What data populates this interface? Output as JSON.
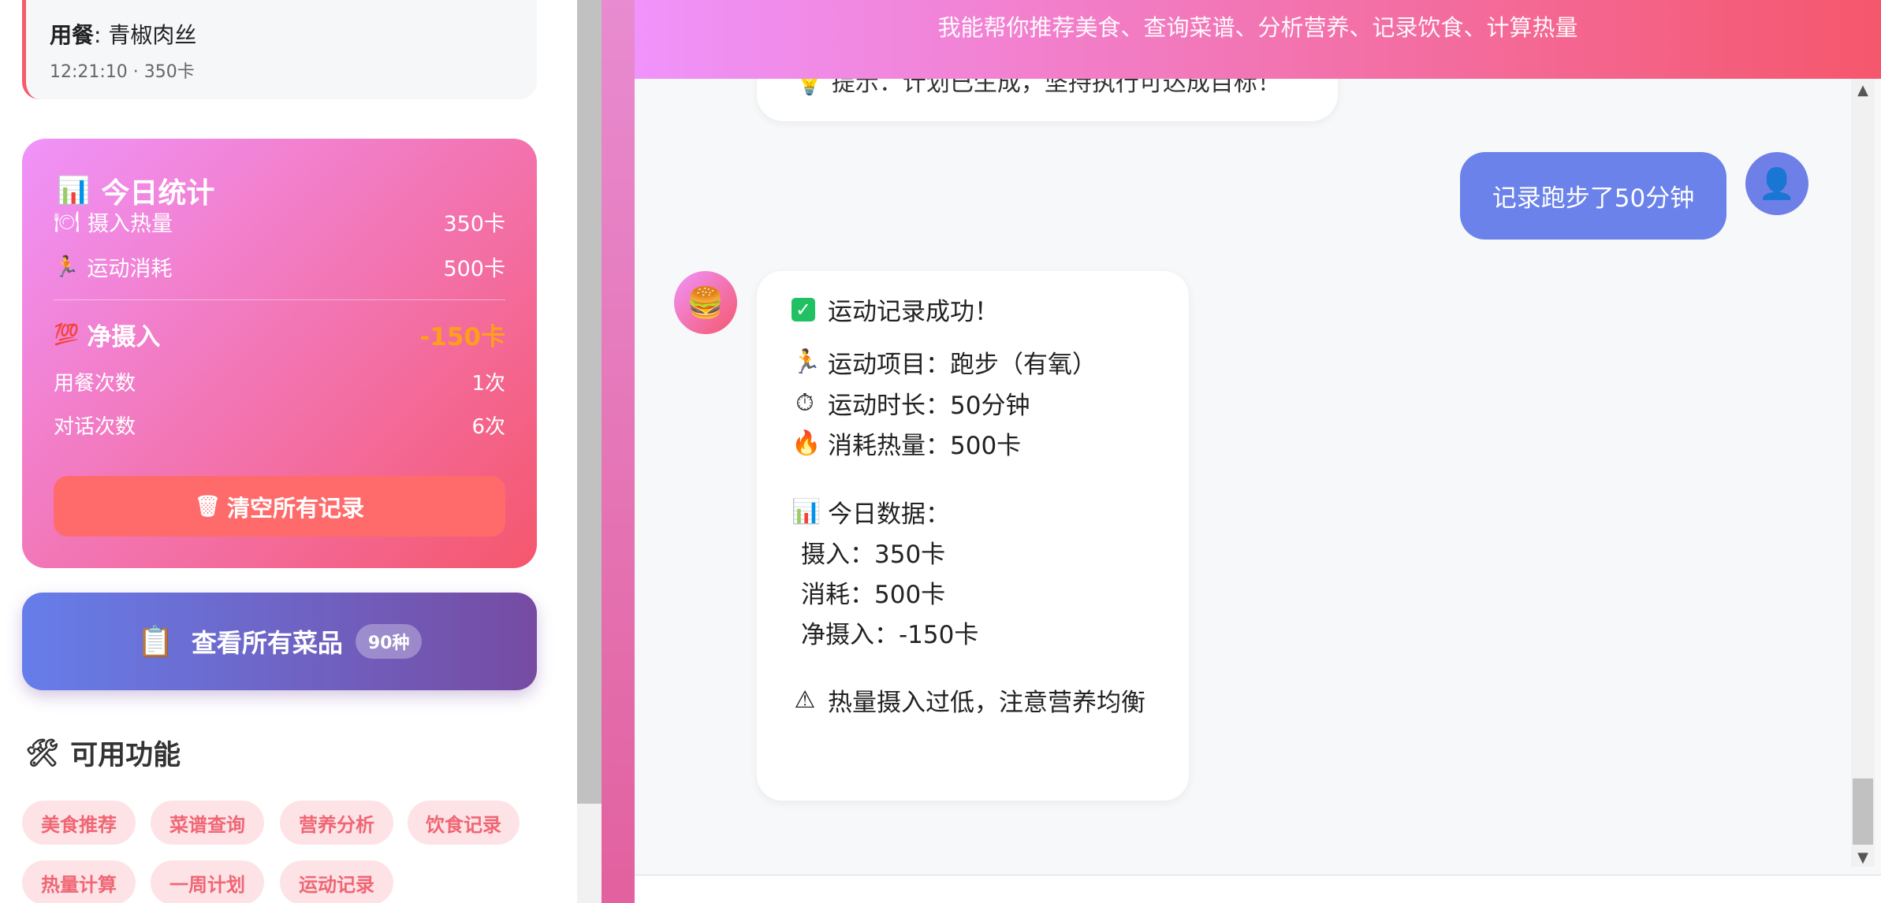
{
  "sidebar": {
    "meal": {
      "label": "用餐",
      "dish": ": 青椒肉丝",
      "meta": "12:21:10 · 350卡"
    },
    "stats": {
      "icon": "bar-chart-icon",
      "title": "今日统计",
      "intake_label": "摄入热量",
      "intake_value": "350卡",
      "burn_label": "运动消耗",
      "burn_value": "500卡",
      "net_label": "净摄入",
      "net_value": "-150卡",
      "meals_label": "用餐次数",
      "meals_value": "1次",
      "chats_label": "对话次数",
      "chats_value": "6次",
      "clear_label": "清空所有记录"
    },
    "menu_button": {
      "label": "查看所有菜品",
      "badge": "90种"
    },
    "features": {
      "title": "可用功能",
      "tags": [
        "美食推荐",
        "菜谱查询",
        "营养分析",
        "饮食记录",
        "热量计算",
        "一周计划",
        "运动记录"
      ]
    }
  },
  "chat": {
    "header": "我能帮你推荐美食、查询菜谱、分析营养、记录饮食、计算热量",
    "prev_message_tail": "提示：计划已生成，坚持执行可达成目标！",
    "user_message": "记录跑步了50分钟",
    "bot_message": {
      "line1": "运动记录成功！",
      "line2": "运动项目：跑步（有氧）",
      "line3": "运动时长：50分钟",
      "line4": "消耗热量：500卡",
      "line5": "今日数据：",
      "line6": "摄入：350卡",
      "line7": "消耗：500卡",
      "line8": "净摄入：-150卡",
      "line9": "热量摄入过低，注意营养均衡"
    }
  },
  "colors": {
    "accent_gradient_start": "#f093fb",
    "accent_gradient_end": "#f5576c",
    "menu_gradient_start": "#667eea",
    "menu_gradient_end": "#764ba2",
    "net_value": "#ff9f1a",
    "tag_bg": "#fde3e6",
    "tag_text": "#f06674"
  }
}
